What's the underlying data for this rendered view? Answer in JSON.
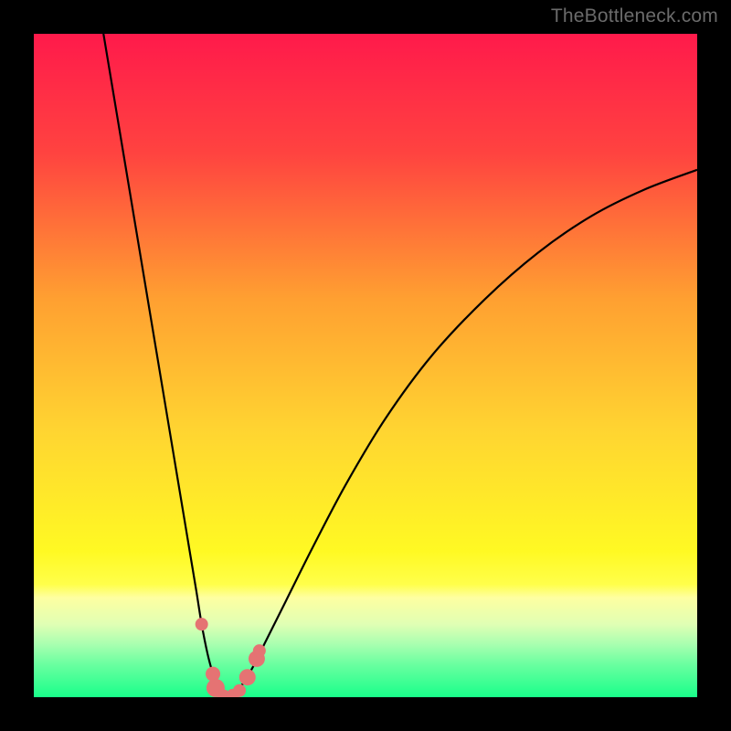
{
  "watermark": "TheBottleneck.com",
  "chart_data": {
    "type": "line",
    "title": "",
    "xlabel": "",
    "ylabel": "",
    "xlim": [
      0,
      100
    ],
    "ylim": [
      0,
      100
    ],
    "grid": false,
    "legend": false,
    "background_gradient_stops": [
      {
        "offset": 0.0,
        "color": "#ff1a4b"
      },
      {
        "offset": 0.18,
        "color": "#ff4340"
      },
      {
        "offset": 0.4,
        "color": "#ffa031"
      },
      {
        "offset": 0.6,
        "color": "#ffd531"
      },
      {
        "offset": 0.78,
        "color": "#fff923"
      },
      {
        "offset": 0.83,
        "color": "#ffff4a"
      },
      {
        "offset": 0.85,
        "color": "#feffa1"
      },
      {
        "offset": 0.89,
        "color": "#e0ffb4"
      },
      {
        "offset": 0.92,
        "color": "#a9ffb0"
      },
      {
        "offset": 0.95,
        "color": "#6bffa0"
      },
      {
        "offset": 1.0,
        "color": "#19ff8a"
      }
    ],
    "series": [
      {
        "name": "curve-left",
        "x": [
          10.5,
          12.5,
          14.5,
          16.5,
          18.5,
          20.5,
          22.5,
          23.5,
          24.5,
          25.3,
          26.2,
          27.0,
          27.6,
          28.2,
          28.8
        ],
        "y": [
          100.0,
          88.0,
          76.0,
          64.0,
          52.0,
          40.0,
          28.0,
          22.0,
          16.0,
          11.0,
          6.5,
          3.5,
          1.8,
          0.7,
          0.0
        ]
      },
      {
        "name": "curve-right",
        "x": [
          28.8,
          30.0,
          31.5,
          33.0,
          35.0,
          38.0,
          42.0,
          47.0,
          53.0,
          60.0,
          68.0,
          76.0,
          84.0,
          92.0,
          100.0
        ],
        "y": [
          0.0,
          0.6,
          2.0,
          4.5,
          8.5,
          14.5,
          22.5,
          32.0,
          42.0,
          51.5,
          60.0,
          67.0,
          72.5,
          76.5,
          79.5
        ]
      }
    ],
    "markers": {
      "name": "critical-points",
      "color": "#e57373",
      "points": [
        {
          "x": 25.3,
          "y": 11.0,
          "r": 7
        },
        {
          "x": 27.0,
          "y": 3.5,
          "r": 8
        },
        {
          "x": 27.4,
          "y": 1.4,
          "r": 10
        },
        {
          "x": 28.6,
          "y": 0.2,
          "r": 7
        },
        {
          "x": 30.0,
          "y": 0.3,
          "r": 7
        },
        {
          "x": 31.0,
          "y": 1.0,
          "r": 7
        },
        {
          "x": 32.2,
          "y": 3.0,
          "r": 9
        },
        {
          "x": 33.6,
          "y": 5.8,
          "r": 9
        },
        {
          "x": 34.0,
          "y": 7.0,
          "r": 7
        }
      ]
    }
  }
}
